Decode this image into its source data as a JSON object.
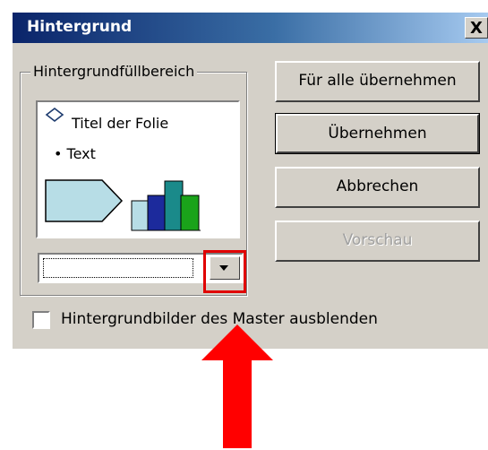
{
  "dialog": {
    "title": "Hintergrund",
    "close_label": "X"
  },
  "fill_area": {
    "group_label": "Hintergrundfüllbereich",
    "preview": {
      "title_text": "Titel der Folie",
      "bullet_text": "• Text"
    },
    "dropdown": {
      "value": ""
    }
  },
  "buttons": {
    "apply_all": "Für alle übernehmen",
    "apply": "Übernehmen",
    "cancel": "Abbrechen",
    "preview": "Vorschau"
  },
  "checkbox": {
    "label": "Hintergrundbilder des Master ausblenden",
    "checked": false
  },
  "colors": {
    "annotation_red": "#e00000",
    "titlebar": "#0a246a",
    "dialog_face": "#d4d0c8"
  }
}
